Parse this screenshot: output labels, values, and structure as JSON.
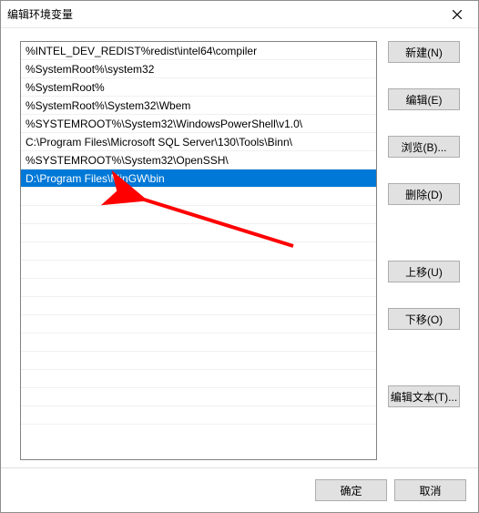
{
  "title": "编辑环境变量",
  "list": {
    "items": [
      {
        "text": "%INTEL_DEV_REDIST%redist\\intel64\\compiler",
        "selected": false
      },
      {
        "text": "%SystemRoot%\\system32",
        "selected": false
      },
      {
        "text": "%SystemRoot%",
        "selected": false
      },
      {
        "text": "%SystemRoot%\\System32\\Wbem",
        "selected": false
      },
      {
        "text": "%SYSTEMROOT%\\System32\\WindowsPowerShell\\v1.0\\",
        "selected": false
      },
      {
        "text": "C:\\Program Files\\Microsoft SQL Server\\130\\Tools\\Binn\\",
        "selected": false
      },
      {
        "text": "%SYSTEMROOT%\\System32\\OpenSSH\\",
        "selected": false
      },
      {
        "text": "D:\\Program Files\\MinGW\\bin",
        "selected": true
      }
    ],
    "empty_count": 13
  },
  "buttons": {
    "new": "新建(N)",
    "edit": "编辑(E)",
    "browse": "浏览(B)...",
    "delete": "删除(D)",
    "moveup": "上移(U)",
    "movedown": "下移(O)",
    "edittext": "编辑文本(T)..."
  },
  "footer": {
    "ok": "确定",
    "cancel": "取消"
  }
}
